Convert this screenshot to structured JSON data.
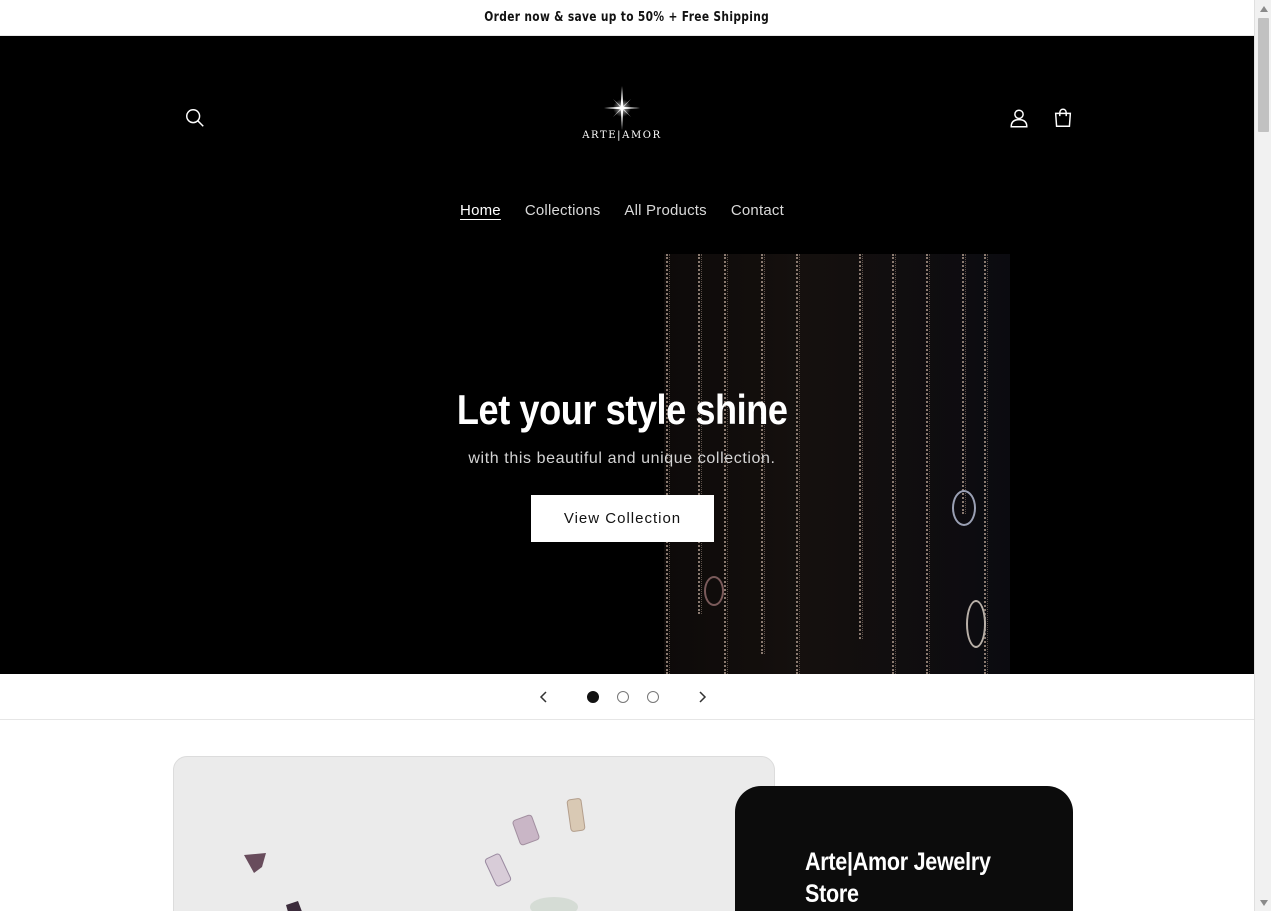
{
  "announcement": {
    "text": "Order now & save up to 50% + Free Shipping"
  },
  "header": {
    "logo_text": "ARTE|AMOR",
    "icons": {
      "search": "search-icon",
      "account": "account-icon",
      "cart": "cart-icon"
    }
  },
  "nav": {
    "items": [
      {
        "label": "Home",
        "active": true
      },
      {
        "label": "Collections",
        "active": false
      },
      {
        "label": "All Products",
        "active": false
      },
      {
        "label": "Contact",
        "active": false
      }
    ]
  },
  "hero": {
    "title": "Let your style shine",
    "subtitle": "with this beautiful and unique collection.",
    "button_label": "View Collection"
  },
  "slider": {
    "slide_count": 3,
    "active_slide": 1
  },
  "feature": {
    "title": "Arte|Amor Jewelry Store"
  },
  "colors": {
    "header_bg": "#000000",
    "button_bg": "#ffffff",
    "card_bg": "#0c0c0c"
  }
}
